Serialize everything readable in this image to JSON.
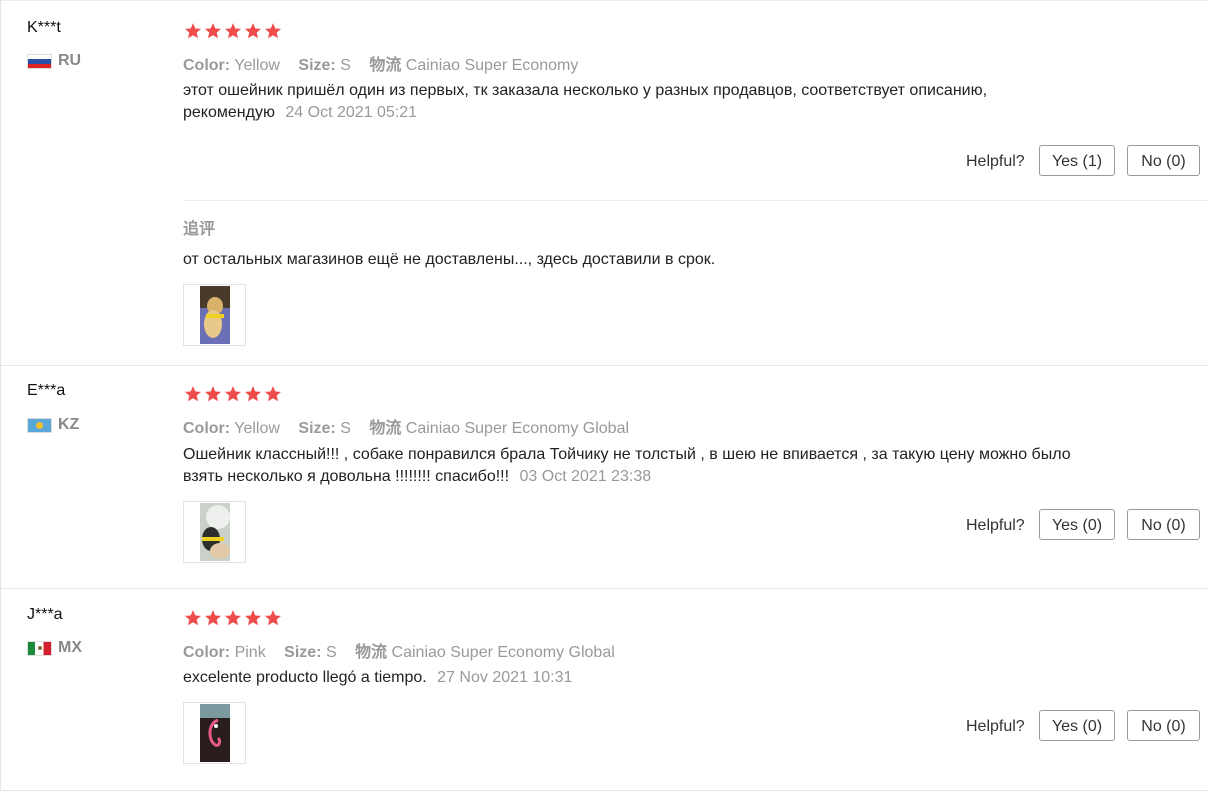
{
  "reviews": [
    {
      "user": "K***t",
      "country": "RU",
      "flag_icon": "russia-flag-icon",
      "rating": 5,
      "color_label": "Color:",
      "color_value": "Yellow",
      "size_label": "Size:",
      "size_value": "S",
      "logistics_label": "物流",
      "logistics_value": "Cainiao Super Economy",
      "text": "этот ошейник пришёл один из первых, тк заказала несколько у разных продавцов, соответствует описанию, рекомендую",
      "date": "24 Oct 2021 05:21",
      "helpful_label": "Helpful?",
      "yes": "Yes (1)",
      "no": "No (0)",
      "followup_label": "追评",
      "followup_text": "от остальных магазинов ещё не доставлены..., здесь доставили в срок."
    },
    {
      "user": "E***a",
      "country": "KZ",
      "flag_icon": "kazakhstan-flag-icon",
      "rating": 5,
      "color_label": "Color:",
      "color_value": "Yellow",
      "size_label": "Size:",
      "size_value": "S",
      "logistics_label": "物流",
      "logistics_value": "Cainiao Super Economy Global",
      "text": "Ошейник классный!!! , собаке понравился брала Тойчику не толстый , в шею не впивается , за такую цену можно было взять несколько я довольна !!!!!!!! спасибо!!!",
      "date": "03 Oct 2021 23:38",
      "helpful_label": "Helpful?",
      "yes": "Yes (0)",
      "no": "No (0)"
    },
    {
      "user": "J***a",
      "country": "MX",
      "flag_icon": "mexico-flag-icon",
      "rating": 5,
      "color_label": "Color:",
      "color_value": "Pink",
      "size_label": "Size:",
      "size_value": "S",
      "logistics_label": "物流",
      "logistics_value": "Cainiao Super Economy Global",
      "text": "excelente producto llegó a tiempo.",
      "date": "27 Nov 2021 10:31",
      "helpful_label": "Helpful?",
      "yes": "Yes (0)",
      "no": "No (0)"
    }
  ],
  "colors": {
    "star": "#ef4b4b",
    "muted": "#999999",
    "text": "#222222"
  }
}
